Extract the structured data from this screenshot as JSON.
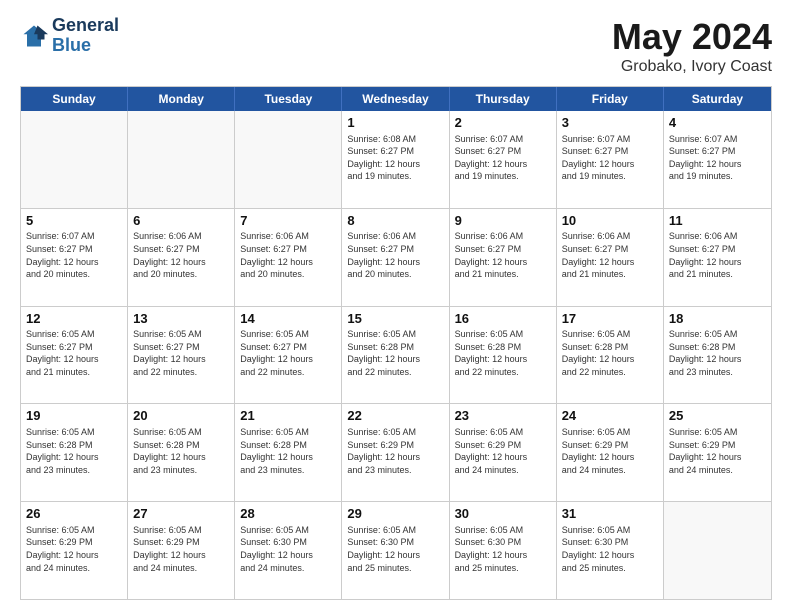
{
  "header": {
    "logo_line1": "General",
    "logo_line2": "Blue",
    "month_title": "May 2024",
    "location": "Grobako, Ivory Coast"
  },
  "days_of_week": [
    "Sunday",
    "Monday",
    "Tuesday",
    "Wednesday",
    "Thursday",
    "Friday",
    "Saturday"
  ],
  "rows": [
    [
      {
        "day": "",
        "info": ""
      },
      {
        "day": "",
        "info": ""
      },
      {
        "day": "",
        "info": ""
      },
      {
        "day": "1",
        "info": "Sunrise: 6:08 AM\nSunset: 6:27 PM\nDaylight: 12 hours\nand 19 minutes."
      },
      {
        "day": "2",
        "info": "Sunrise: 6:07 AM\nSunset: 6:27 PM\nDaylight: 12 hours\nand 19 minutes."
      },
      {
        "day": "3",
        "info": "Sunrise: 6:07 AM\nSunset: 6:27 PM\nDaylight: 12 hours\nand 19 minutes."
      },
      {
        "day": "4",
        "info": "Sunrise: 6:07 AM\nSunset: 6:27 PM\nDaylight: 12 hours\nand 19 minutes."
      }
    ],
    [
      {
        "day": "5",
        "info": "Sunrise: 6:07 AM\nSunset: 6:27 PM\nDaylight: 12 hours\nand 20 minutes."
      },
      {
        "day": "6",
        "info": "Sunrise: 6:06 AM\nSunset: 6:27 PM\nDaylight: 12 hours\nand 20 minutes."
      },
      {
        "day": "7",
        "info": "Sunrise: 6:06 AM\nSunset: 6:27 PM\nDaylight: 12 hours\nand 20 minutes."
      },
      {
        "day": "8",
        "info": "Sunrise: 6:06 AM\nSunset: 6:27 PM\nDaylight: 12 hours\nand 20 minutes."
      },
      {
        "day": "9",
        "info": "Sunrise: 6:06 AM\nSunset: 6:27 PM\nDaylight: 12 hours\nand 21 minutes."
      },
      {
        "day": "10",
        "info": "Sunrise: 6:06 AM\nSunset: 6:27 PM\nDaylight: 12 hours\nand 21 minutes."
      },
      {
        "day": "11",
        "info": "Sunrise: 6:06 AM\nSunset: 6:27 PM\nDaylight: 12 hours\nand 21 minutes."
      }
    ],
    [
      {
        "day": "12",
        "info": "Sunrise: 6:05 AM\nSunset: 6:27 PM\nDaylight: 12 hours\nand 21 minutes."
      },
      {
        "day": "13",
        "info": "Sunrise: 6:05 AM\nSunset: 6:27 PM\nDaylight: 12 hours\nand 22 minutes."
      },
      {
        "day": "14",
        "info": "Sunrise: 6:05 AM\nSunset: 6:27 PM\nDaylight: 12 hours\nand 22 minutes."
      },
      {
        "day": "15",
        "info": "Sunrise: 6:05 AM\nSunset: 6:28 PM\nDaylight: 12 hours\nand 22 minutes."
      },
      {
        "day": "16",
        "info": "Sunrise: 6:05 AM\nSunset: 6:28 PM\nDaylight: 12 hours\nand 22 minutes."
      },
      {
        "day": "17",
        "info": "Sunrise: 6:05 AM\nSunset: 6:28 PM\nDaylight: 12 hours\nand 22 minutes."
      },
      {
        "day": "18",
        "info": "Sunrise: 6:05 AM\nSunset: 6:28 PM\nDaylight: 12 hours\nand 23 minutes."
      }
    ],
    [
      {
        "day": "19",
        "info": "Sunrise: 6:05 AM\nSunset: 6:28 PM\nDaylight: 12 hours\nand 23 minutes."
      },
      {
        "day": "20",
        "info": "Sunrise: 6:05 AM\nSunset: 6:28 PM\nDaylight: 12 hours\nand 23 minutes."
      },
      {
        "day": "21",
        "info": "Sunrise: 6:05 AM\nSunset: 6:28 PM\nDaylight: 12 hours\nand 23 minutes."
      },
      {
        "day": "22",
        "info": "Sunrise: 6:05 AM\nSunset: 6:29 PM\nDaylight: 12 hours\nand 23 minutes."
      },
      {
        "day": "23",
        "info": "Sunrise: 6:05 AM\nSunset: 6:29 PM\nDaylight: 12 hours\nand 24 minutes."
      },
      {
        "day": "24",
        "info": "Sunrise: 6:05 AM\nSunset: 6:29 PM\nDaylight: 12 hours\nand 24 minutes."
      },
      {
        "day": "25",
        "info": "Sunrise: 6:05 AM\nSunset: 6:29 PM\nDaylight: 12 hours\nand 24 minutes."
      }
    ],
    [
      {
        "day": "26",
        "info": "Sunrise: 6:05 AM\nSunset: 6:29 PM\nDaylight: 12 hours\nand 24 minutes."
      },
      {
        "day": "27",
        "info": "Sunrise: 6:05 AM\nSunset: 6:29 PM\nDaylight: 12 hours\nand 24 minutes."
      },
      {
        "day": "28",
        "info": "Sunrise: 6:05 AM\nSunset: 6:30 PM\nDaylight: 12 hours\nand 24 minutes."
      },
      {
        "day": "29",
        "info": "Sunrise: 6:05 AM\nSunset: 6:30 PM\nDaylight: 12 hours\nand 25 minutes."
      },
      {
        "day": "30",
        "info": "Sunrise: 6:05 AM\nSunset: 6:30 PM\nDaylight: 12 hours\nand 25 minutes."
      },
      {
        "day": "31",
        "info": "Sunrise: 6:05 AM\nSunset: 6:30 PM\nDaylight: 12 hours\nand 25 minutes."
      },
      {
        "day": "",
        "info": ""
      }
    ]
  ]
}
